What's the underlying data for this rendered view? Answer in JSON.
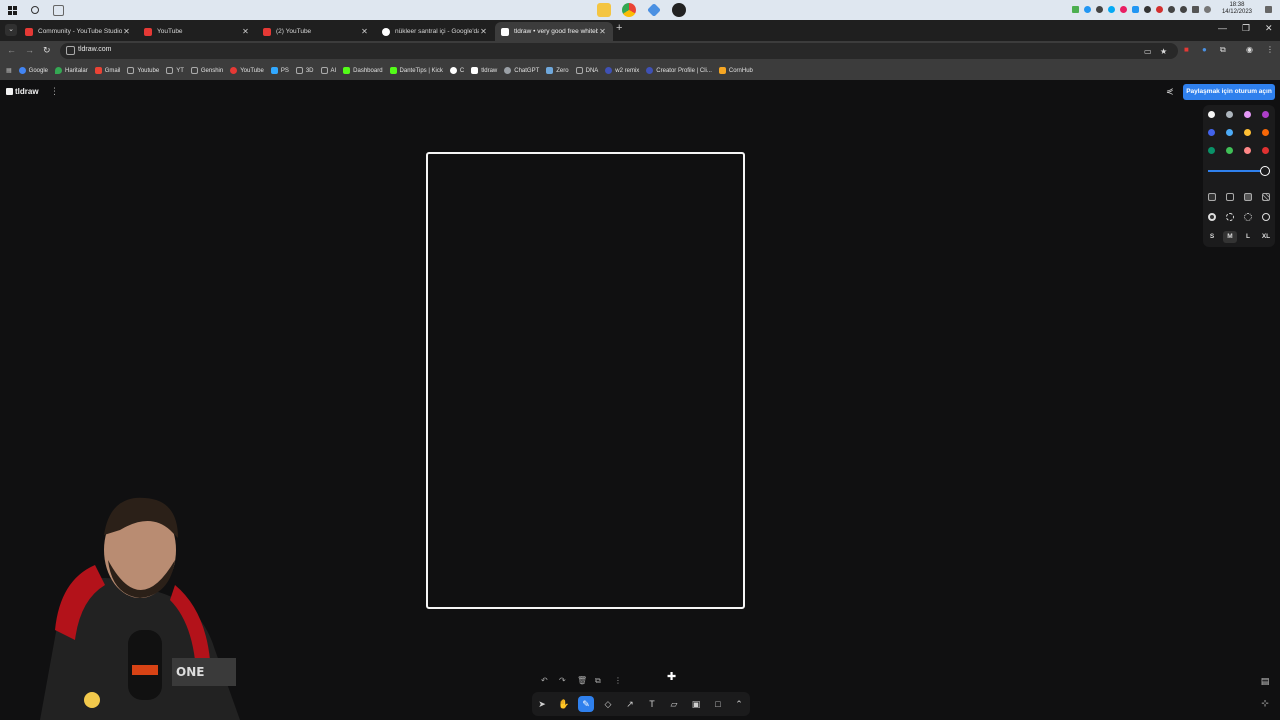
{
  "taskbar": {
    "clock_time": "18:38",
    "clock_date": "14/12/2023"
  },
  "browser": {
    "tabs": [
      {
        "title": "Community - YouTube Studio",
        "color": "#e53935"
      },
      {
        "title": "YouTube",
        "color": "#e53935"
      },
      {
        "title": "(2) YouTube",
        "color": "#e53935"
      },
      {
        "title": "nükleer santral içi - Google'da Ara",
        "color": "#ffffff"
      },
      {
        "title": "tldraw • very good free whiteboard",
        "color": "#ffffff"
      }
    ],
    "new_tab": "+",
    "url": "tldraw.com",
    "bookmarks": [
      {
        "label": "Google",
        "color": "#4285f4"
      },
      {
        "label": "Haritalar",
        "color": "#34a853"
      },
      {
        "label": "Gmail",
        "color": "#ea4335"
      },
      {
        "label": "Youtube",
        "color": "#9aa0a6"
      },
      {
        "label": "YT",
        "color": "#9aa0a6"
      },
      {
        "label": "Genshin",
        "color": "#9aa0a6"
      },
      {
        "label": "YouTube",
        "color": "#e53935"
      },
      {
        "label": "PS",
        "color": "#31a8ff"
      },
      {
        "label": "3D",
        "color": "#9aa0a6"
      },
      {
        "label": "AI",
        "color": "#9aa0a6"
      },
      {
        "label": "Dashboard",
        "color": "#53fc18"
      },
      {
        "label": "DanteTips | Kick",
        "color": "#53fc18"
      },
      {
        "label": "C",
        "color": "#ffffff"
      },
      {
        "label": "tldraw",
        "color": "#ffffff"
      },
      {
        "label": "ChatGPT",
        "color": "#9aa0a6"
      },
      {
        "label": "Zero",
        "color": "#6fa8dc"
      },
      {
        "label": "DNA",
        "color": "#9aa0a6"
      },
      {
        "label": "w2 remix",
        "color": "#3f51b5"
      },
      {
        "label": "Creator Profile | Cli...",
        "color": "#3f51b5"
      },
      {
        "label": "CornHub",
        "color": "#f5a623"
      }
    ]
  },
  "app": {
    "logo_text": "tldraw",
    "signin_label": "Paylaşmak için oturum açın",
    "colors": [
      "#f5f5f5",
      "#adb5bd",
      "#e599f7",
      "#ae3ec9",
      "#4263eb",
      "#4dabf7",
      "#ffc034",
      "#f76707",
      "#099268",
      "#40c057",
      "#ff8787",
      "#e03131"
    ],
    "accent": "#2f80ed",
    "opacity": 1,
    "sizes": [
      "S",
      "M",
      "L",
      "XL"
    ],
    "selected_size": "M",
    "selected_tool": "draw"
  }
}
